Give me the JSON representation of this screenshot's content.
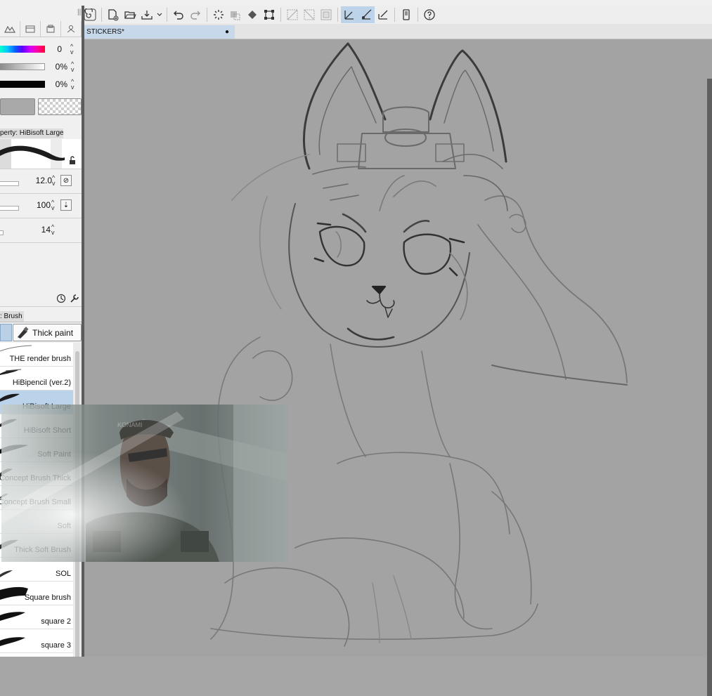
{
  "app": {
    "accent": "#bad2ea"
  },
  "document_tab": {
    "title": "STICKERS*",
    "status_dot": "●"
  },
  "color_panel": {
    "hue_value": "0",
    "saturation_value": "0%",
    "value_value": "0%"
  },
  "tool_property": {
    "header": "perty: HiBisoft Large",
    "brush_size": "12.0",
    "opacity": "100",
    "third_value": "14"
  },
  "sub_tool": {
    "header": ": Brush",
    "thick_paint_label": "Thick paint",
    "selected": "HiBisoft Large",
    "brushes": [
      {
        "name": "THE render brush"
      },
      {
        "name": "HiBipencil (ver.2)"
      },
      {
        "name": "HiBisoft Large"
      },
      {
        "name": "HiBisoft Short"
      },
      {
        "name": "Soft Paint"
      },
      {
        "name": "Concept Brush Thick"
      },
      {
        "name": "Concept Brush Small"
      },
      {
        "name": "Soft"
      },
      {
        "name": "Thick Soft Brush"
      },
      {
        "name": "SOL"
      },
      {
        "name": "Square brush"
      },
      {
        "name": "square 2"
      },
      {
        "name": "square 3"
      }
    ]
  },
  "overlay_image": {
    "watermark": "KONAMI"
  },
  "icons": [
    "spiral-icon",
    "new-file-icon",
    "open-folder-icon",
    "save-icon",
    "undo-icon",
    "redo-icon",
    "loading-icon",
    "clear-icon",
    "fill-icon",
    "transform-icon",
    "select-icon",
    "deselect-icon",
    "frame-icon",
    "pen-icon",
    "brush-icon",
    "ruler-pen-icon",
    "tablet-icon",
    "help-icon"
  ]
}
